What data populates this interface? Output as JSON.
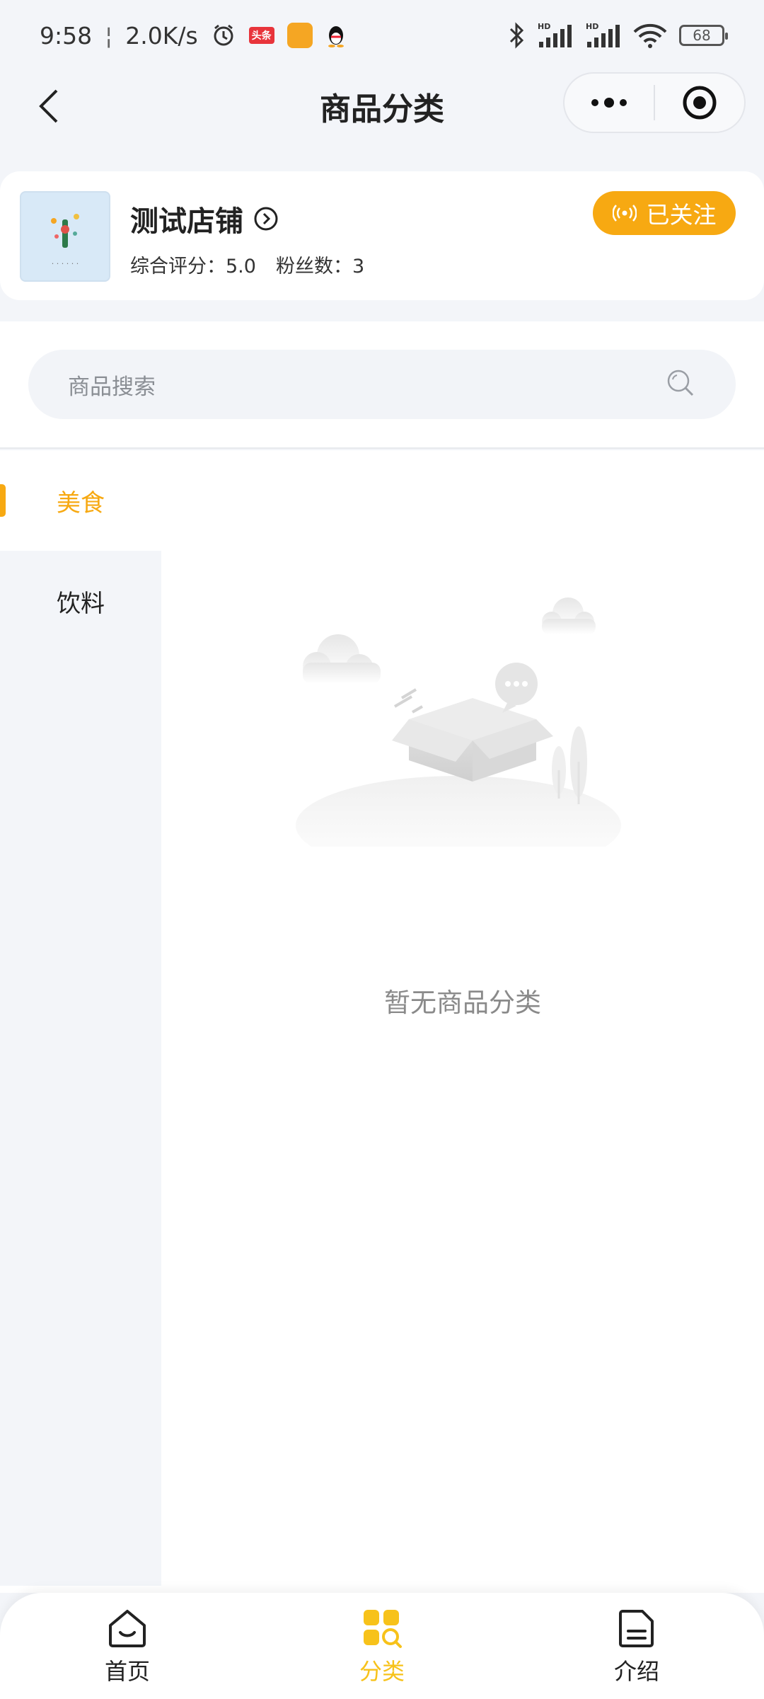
{
  "status_bar": {
    "time": "9:58",
    "net_speed": "2.0K/s",
    "app_badge_text": "头条",
    "battery": "68",
    "signal_label_1": "HD",
    "signal_label_2": "HD"
  },
  "nav": {
    "title": "商品分类"
  },
  "shop": {
    "name": "测试店铺",
    "rating_label": "综合评分：",
    "rating": "5.0",
    "fans_label": "粉丝数：",
    "fans": "3",
    "follow_label": "已关注"
  },
  "search": {
    "placeholder": "商品搜索"
  },
  "categories": [
    {
      "label": "美食",
      "active": true
    },
    {
      "label": "饮料",
      "active": false
    }
  ],
  "empty_state": {
    "text": "暂无商品分类"
  },
  "tabs": [
    {
      "label": "首页",
      "icon": "home-icon"
    },
    {
      "label": "分类",
      "icon": "category-icon"
    },
    {
      "label": "介绍",
      "icon": "document-icon"
    }
  ],
  "colors": {
    "accent": "#f7a912",
    "tab_active": "#f7c21a",
    "background": "#f3f5f9"
  }
}
